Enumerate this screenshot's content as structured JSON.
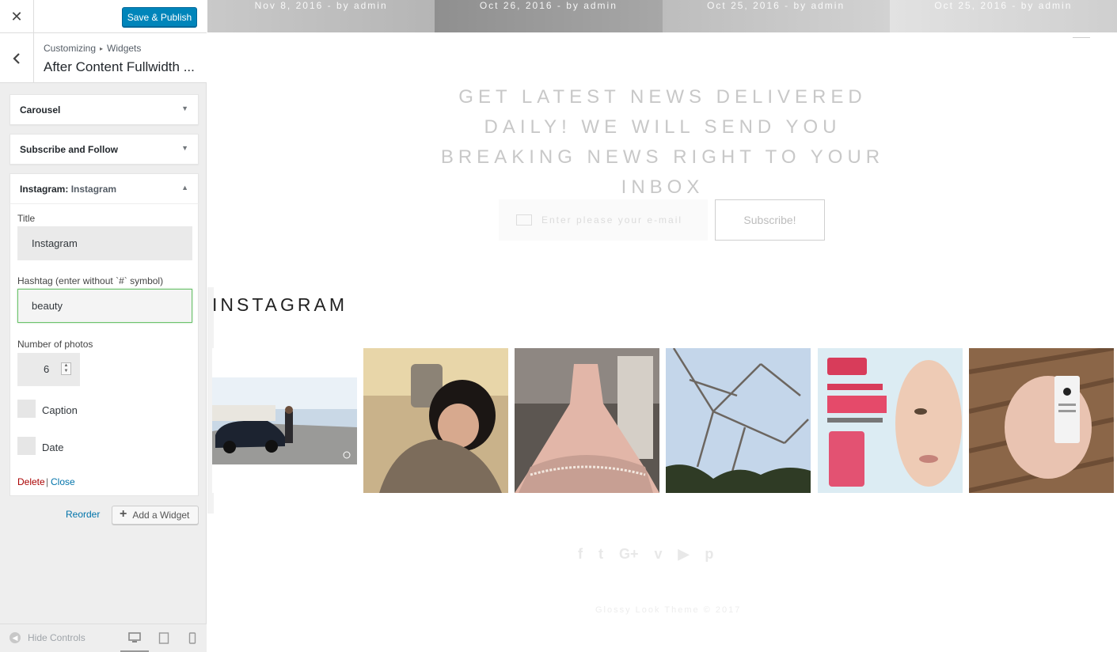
{
  "topbar": {
    "close_glyph": "✕",
    "save_label": "Save & Publish"
  },
  "section": {
    "breadcrumb_root": "Customizing",
    "breadcrumb_sep": "▸",
    "breadcrumb_leaf": "Widgets",
    "title": "After Content Fullwidth ..."
  },
  "widgets": [
    {
      "title": "Carousel",
      "arrow": "▼"
    },
    {
      "title": "Subscribe and Follow",
      "arrow": "▼"
    },
    {
      "title": "Instagram:",
      "in_title": "Instagram",
      "arrow": "▲"
    }
  ],
  "instagram_form": {
    "title_label": "Title",
    "title_value": "Instagram",
    "hashtag_label": "Hashtag (enter without `#` symbol)",
    "hashtag_value": "beauty",
    "photos_label": "Number of photos",
    "photos_value": "6",
    "caption_label": "Caption",
    "date_label": "Date",
    "delete_label": "Delete",
    "pipe": "|",
    "close_label": "Close"
  },
  "actions": {
    "reorder_label": "Reorder",
    "add_widget_label": "Add a Widget",
    "add_icon": "+"
  },
  "footer": {
    "hide_controls_label": "Hide Controls",
    "hide_icon": "◀"
  },
  "preview": {
    "posts": [
      {
        "meta": "Nov 8, 2016  -  by admin"
      },
      {
        "meta": "Oct 26, 2016  -  by admin"
      },
      {
        "meta": "Oct 25, 2016  -  by admin"
      },
      {
        "meta": "Oct 25, 2016  -  by admin"
      }
    ],
    "news_heading": "GET LATEST NEWS DELIVERED DAILY! WE WILL SEND YOU BREAKING NEWS RIGHT TO YOUR INBOX",
    "email_placeholder": "Enter please your e-mail",
    "subscribe_label": "Subscribe!",
    "instagram_heading": "INSTAGRAM",
    "social_icons": [
      "f",
      "t",
      "G+",
      "v",
      "▶",
      "p"
    ],
    "copyright": "Glossy Look Theme © 2017"
  },
  "colors": {
    "accent": "#0085ba",
    "link": "#0073aa",
    "delete": "#aa0000",
    "focus": "#6cc26c"
  }
}
